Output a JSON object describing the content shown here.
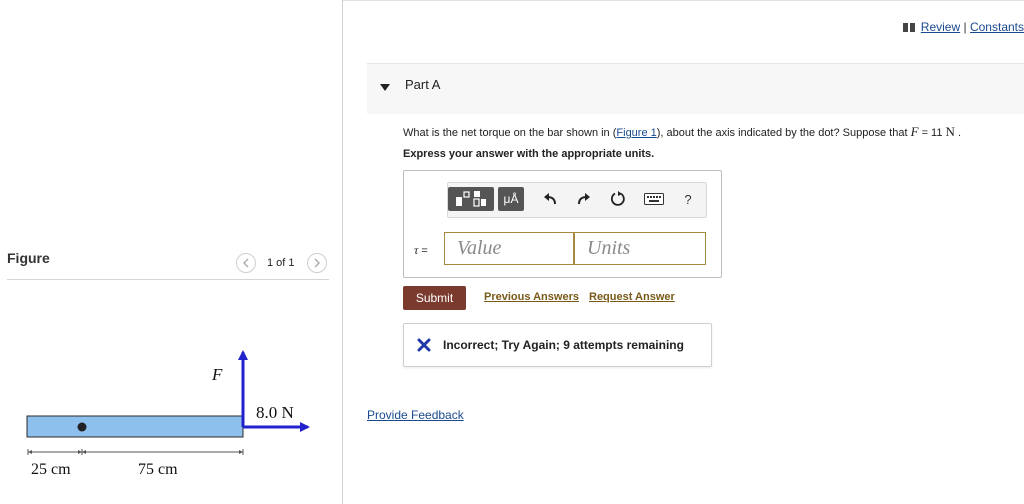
{
  "header": {
    "review_label": "Review",
    "separator": "|",
    "constants_label": "Constants"
  },
  "part": {
    "title": "Part A"
  },
  "question": {
    "prefix": "What is the net torque on the bar shown in (",
    "figure_link": "Figure 1",
    "middle": "), about the axis indicated by the dot? Suppose that ",
    "var": "F",
    "equals": " = 11 ",
    "unit": "N",
    "suffix": " ."
  },
  "instruction": "Express your answer with the appropriate units.",
  "toolbar": {
    "units_symbol": "μÅ",
    "help_symbol": "?"
  },
  "answer": {
    "label_var": "τ",
    "label_eq": " =",
    "value_placeholder": "Value",
    "units_placeholder": "Units",
    "value": "",
    "units": ""
  },
  "actions": {
    "submit_label": "Submit",
    "previous_answers_label": "Previous Answers",
    "request_answer_label": "Request Answer"
  },
  "feedback": {
    "message": "Incorrect; Try Again; 9 attempts remaining",
    "status_color": "#1f3aa8"
  },
  "provide_feedback_label": "Provide Feedback",
  "figure": {
    "label": "Figure",
    "count": "1 of 1",
    "force_label": "F",
    "horizontal_force_label": "8.0 N",
    "left_dim": "25 cm",
    "right_dim": "75 cm",
    "bar_color": "#8ec0ee",
    "arrow_color": "#2222cc"
  }
}
